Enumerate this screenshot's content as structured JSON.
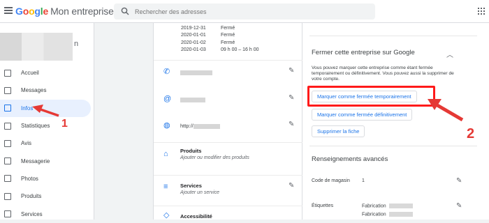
{
  "header": {
    "logo_g1": "G",
    "logo_g2": "o",
    "logo_g3": "o",
    "logo_g4": "g",
    "logo_g5": "l",
    "logo_g6": "e",
    "product": "Mon entreprise",
    "search_placeholder": "Rechercher des adresses"
  },
  "sidebar": {
    "business_name_suffix": "n",
    "items": [
      {
        "label": "Accueil",
        "icon": "dashboard-icon"
      },
      {
        "label": "Messages",
        "icon": "messages-icon"
      },
      {
        "label": "Infos",
        "icon": "store-icon",
        "active": true
      },
      {
        "label": "Statistiques",
        "icon": "insights-icon"
      },
      {
        "label": "Avis",
        "icon": "reviews-icon"
      },
      {
        "label": "Messagerie",
        "icon": "chat-icon"
      },
      {
        "label": "Photos",
        "icon": "photos-icon"
      },
      {
        "label": "Produits",
        "icon": "basket-icon"
      },
      {
        "label": "Services",
        "icon": "list-icon"
      }
    ]
  },
  "hours": [
    {
      "date": "2019-12-31",
      "value": "Fermé"
    },
    {
      "date": "2020-01-01",
      "value": "Fermé"
    },
    {
      "date": "2020-01-02",
      "value": "Fermé"
    },
    {
      "date": "2020-01-03",
      "value": "09 h 00 – 16 h 00"
    }
  ],
  "info": {
    "website_prefix": "http://",
    "products_title": "Produits",
    "products_sub": "Ajouter ou modifier des produits",
    "services_title": "Services",
    "services_sub": "Ajouter un service",
    "accessibility_title": "Accessibilité"
  },
  "close_panel": {
    "title": "Fermer cette entreprise sur Google",
    "description": "Vous pouvez marquer cette entreprise comme étant fermée temporairement ou définitivement. Vous pouvez aussi la supprimer de votre compte.",
    "btn_temporary": "Marquer comme fermée temporairement",
    "btn_permanent": "Marquer comme fermée définitivement",
    "btn_delete": "Supprimer la fiche"
  },
  "advanced": {
    "title": "Renseignements avancés",
    "store_code_label": "Code de magasin",
    "store_code_value": "1",
    "labels_label": "Étiquettes",
    "labels_values": [
      "Fabrication",
      "Fabrication"
    ]
  },
  "annotations": {
    "one": "1",
    "two": "2"
  },
  "colors": {
    "accent": "#1a73e8",
    "highlight": "#ff1a1a",
    "active_bg": "#e8f0fe"
  }
}
